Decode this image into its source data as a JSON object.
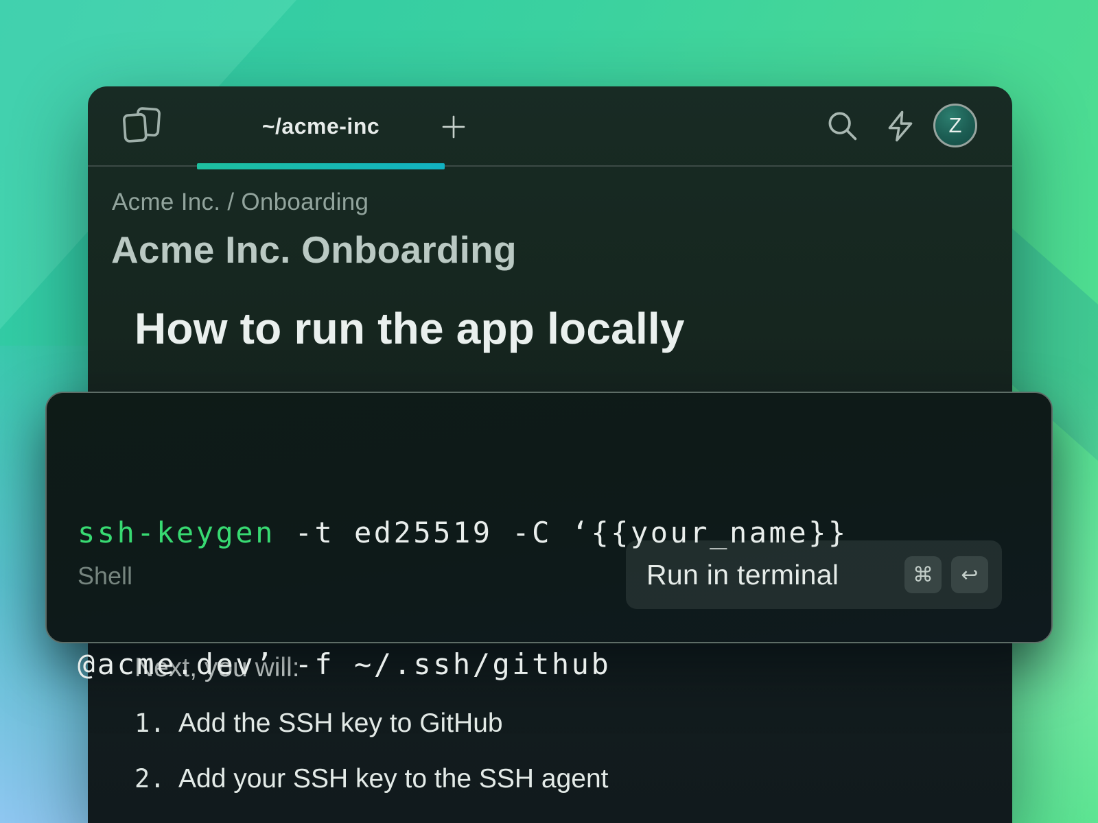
{
  "header": {
    "tab_title": "~/acme-inc",
    "avatar_initial": "Z",
    "icons": [
      "library-icon",
      "new-tab-icon",
      "search-icon",
      "quick-actions-icon"
    ]
  },
  "breadcrumb": {
    "parent": "Acme Inc.",
    "separator": "/",
    "current": "Onboarding"
  },
  "document": {
    "title": "Acme Inc. Onboarding",
    "heading": "How to run the app locally"
  },
  "code_card": {
    "language": "Shell",
    "lines": [
      {
        "command": "ssh-keygen",
        "rest": " -t ed25519 -C ‘{{your_name}}"
      },
      {
        "command": "",
        "rest": "@acme.dev’ -f ~/.ssh/github"
      }
    ],
    "run_button": {
      "label": "Run in terminal",
      "keys": [
        "⌘",
        "↩"
      ]
    }
  },
  "next_steps": {
    "intro": "Next, you will:",
    "items": [
      {
        "number": "1.",
        "text": "Add the SSH key to GitHub"
      },
      {
        "number": "2.",
        "text": "Add your SSH key to the SSH agent"
      }
    ]
  },
  "colors": {
    "tab_accent_left": "#1ec09f",
    "tab_accent_right": "#12b2c2",
    "command_green": "#38da72",
    "window_bg_top": "#182b24",
    "window_bg_bottom": "#111a1d"
  }
}
